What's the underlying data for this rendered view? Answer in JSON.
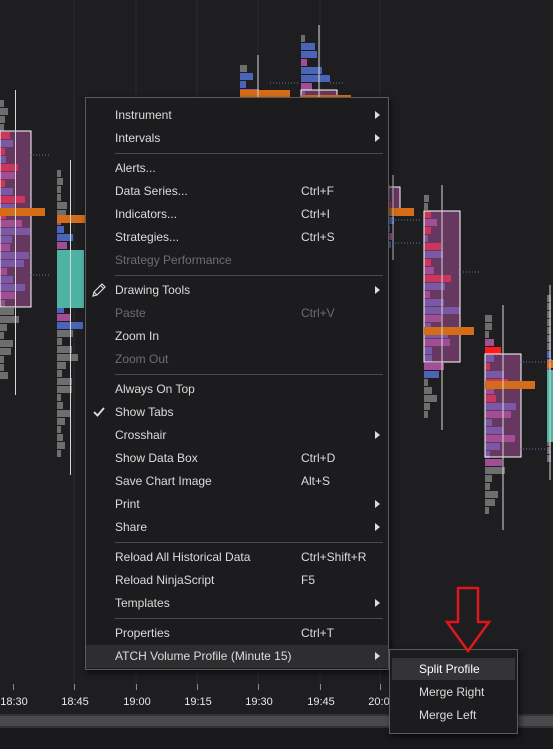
{
  "colors": {
    "background": "#1e1e20",
    "menu_bg": "#1c1c1e",
    "annotation_arrow": "#e0161d",
    "profile_red": "#ff1a1a",
    "profile_blue": "#4a64b8",
    "profile_purple": "#a24e95",
    "profile_gray": "#6e6e6e",
    "poc_orange": "#d46c18",
    "value_area_teal": "#4fb3a4"
  },
  "time_axis": {
    "ticks": [
      "18:30",
      "18:45",
      "19:00",
      "19:15",
      "19:30",
      "19:45",
      "20:0"
    ]
  },
  "context_menu": {
    "items": [
      {
        "label": "Instrument",
        "shortcut": "",
        "submenu": true,
        "disabled": false,
        "icon": ""
      },
      {
        "label": "Intervals",
        "shortcut": "",
        "submenu": true,
        "disabled": false,
        "icon": ""
      },
      {
        "label": "Alerts...",
        "shortcut": "",
        "submenu": false,
        "disabled": false,
        "icon": ""
      },
      {
        "label": "Data Series...",
        "shortcut": "Ctrl+F",
        "submenu": false,
        "disabled": false,
        "icon": ""
      },
      {
        "label": "Indicators...",
        "shortcut": "Ctrl+I",
        "submenu": false,
        "disabled": false,
        "icon": ""
      },
      {
        "label": "Strategies...",
        "shortcut": "Ctrl+S",
        "submenu": false,
        "disabled": false,
        "icon": ""
      },
      {
        "label": "Strategy Performance",
        "shortcut": "",
        "submenu": false,
        "disabled": true,
        "icon": ""
      },
      {
        "label": "Drawing Tools",
        "shortcut": "",
        "submenu": true,
        "disabled": false,
        "icon": "pencil-icon"
      },
      {
        "label": "Paste",
        "shortcut": "Ctrl+V",
        "submenu": false,
        "disabled": true,
        "icon": ""
      },
      {
        "label": "Zoom In",
        "shortcut": "",
        "submenu": false,
        "disabled": false,
        "icon": ""
      },
      {
        "label": "Zoom Out",
        "shortcut": "",
        "submenu": false,
        "disabled": true,
        "icon": ""
      },
      {
        "label": "Always On Top",
        "shortcut": "",
        "submenu": false,
        "disabled": false,
        "icon": ""
      },
      {
        "label": "Show Tabs",
        "shortcut": "",
        "submenu": false,
        "disabled": false,
        "icon": "checkmark-icon"
      },
      {
        "label": "Crosshair",
        "shortcut": "",
        "submenu": true,
        "disabled": false,
        "icon": ""
      },
      {
        "label": "Show Data Box",
        "shortcut": "Ctrl+D",
        "submenu": false,
        "disabled": false,
        "icon": ""
      },
      {
        "label": "Save Chart Image",
        "shortcut": "Alt+S",
        "submenu": false,
        "disabled": false,
        "icon": ""
      },
      {
        "label": "Print",
        "shortcut": "",
        "submenu": true,
        "disabled": false,
        "icon": ""
      },
      {
        "label": "Share",
        "shortcut": "",
        "submenu": true,
        "disabled": false,
        "icon": ""
      },
      {
        "label": "Reload All Historical Data",
        "shortcut": "Ctrl+Shift+R",
        "submenu": false,
        "disabled": false,
        "icon": ""
      },
      {
        "label": "Reload NinjaScript",
        "shortcut": "F5",
        "submenu": false,
        "disabled": false,
        "icon": ""
      },
      {
        "label": "Templates",
        "shortcut": "",
        "submenu": true,
        "disabled": false,
        "icon": ""
      },
      {
        "label": "Properties",
        "shortcut": "Ctrl+T",
        "submenu": false,
        "disabled": false,
        "icon": ""
      },
      {
        "label": "ATCH Volume Profile (Minute 15)",
        "shortcut": "",
        "submenu": true,
        "disabled": false,
        "icon": ""
      }
    ]
  },
  "submenu": {
    "items": [
      {
        "label": "Split Profile",
        "active": true
      },
      {
        "label": "Merge Right",
        "active": false
      },
      {
        "label": "Merge Left",
        "active": false
      }
    ]
  }
}
